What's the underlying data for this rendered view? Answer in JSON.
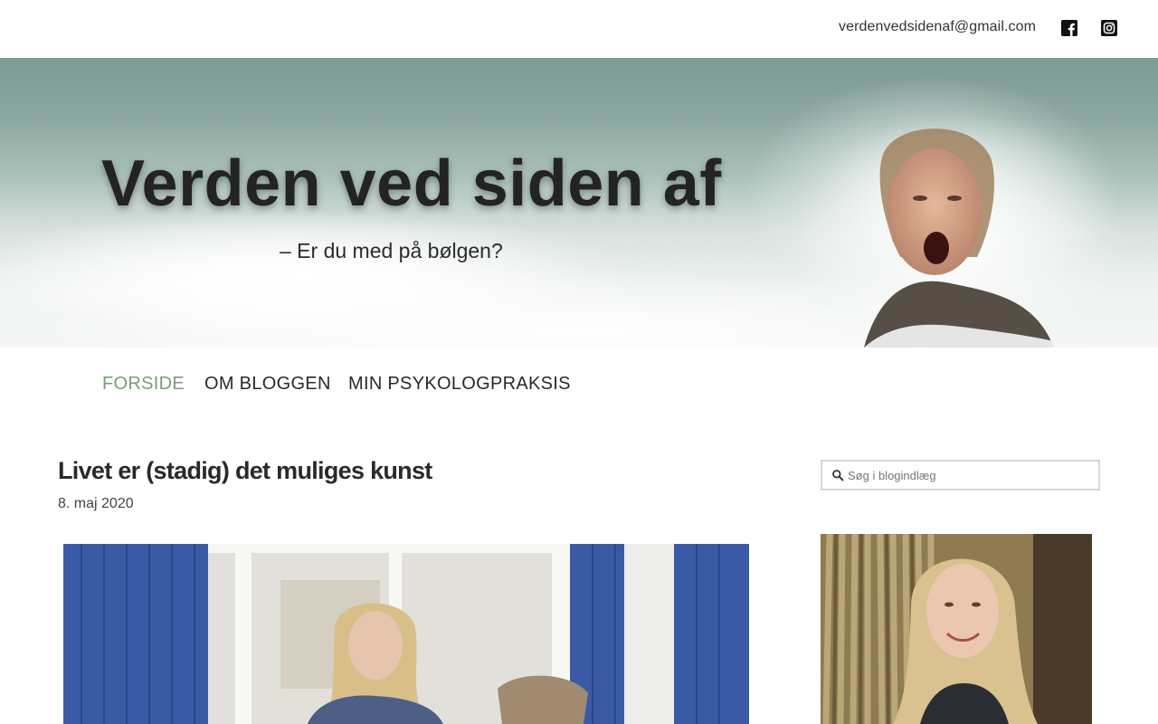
{
  "header": {
    "email": "verdenvedsidenaf@gmail.com",
    "social_icons": [
      "facebook-icon",
      "instagram-icon"
    ]
  },
  "hero": {
    "title": "Verden ved siden af",
    "tagline": "– Er du med på bølgen?"
  },
  "nav": {
    "items": [
      {
        "label": "FORSIDE",
        "active": true
      },
      {
        "label": "OM BLOGGEN",
        "active": false
      },
      {
        "label": "MIN PSYKOLOGPRAKSIS",
        "active": false
      }
    ]
  },
  "post": {
    "title": "Livet er (stadig) det muliges kunst",
    "date": "8. maj 2020"
  },
  "sidebar": {
    "search_placeholder": "Søg i blogindlæg",
    "search_value": ""
  },
  "colors": {
    "accent": "#7d9c79",
    "text": "#2a2a2a"
  }
}
